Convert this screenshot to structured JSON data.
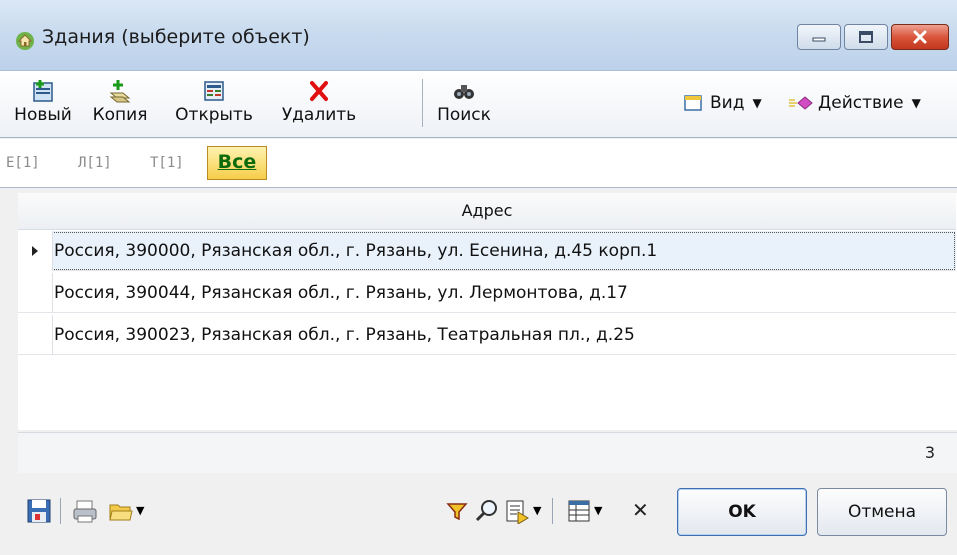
{
  "window": {
    "title": "Здания (выберите объект)",
    "accent": "#bcd1ea",
    "close_color": "#d9553c"
  },
  "toolbar": {
    "new_label": "Новый",
    "copy_label": "Копия",
    "open_label": "Открыть",
    "delete_label": "Удалить",
    "search_label": "Поиск",
    "view_label": "Вид",
    "action_label": "Действие"
  },
  "filters": {
    "items": [
      "Е[1]",
      "Л[1]",
      "Т[1]"
    ],
    "all_label": "Все"
  },
  "grid": {
    "column_header": "Адрес",
    "rows": [
      "Россия, 390000, Рязанская обл., г. Рязань, ул. Есенина, д.45 корп.1",
      "Россия, 390044, Рязанская обл., г. Рязань, ул. Лермонтова, д.17",
      "Россия, 390023, Рязанская обл., г. Рязань, Театральная пл., д.25"
    ],
    "count": "3"
  },
  "buttons": {
    "ok_label": "OK",
    "cancel_label": "Отмена"
  }
}
